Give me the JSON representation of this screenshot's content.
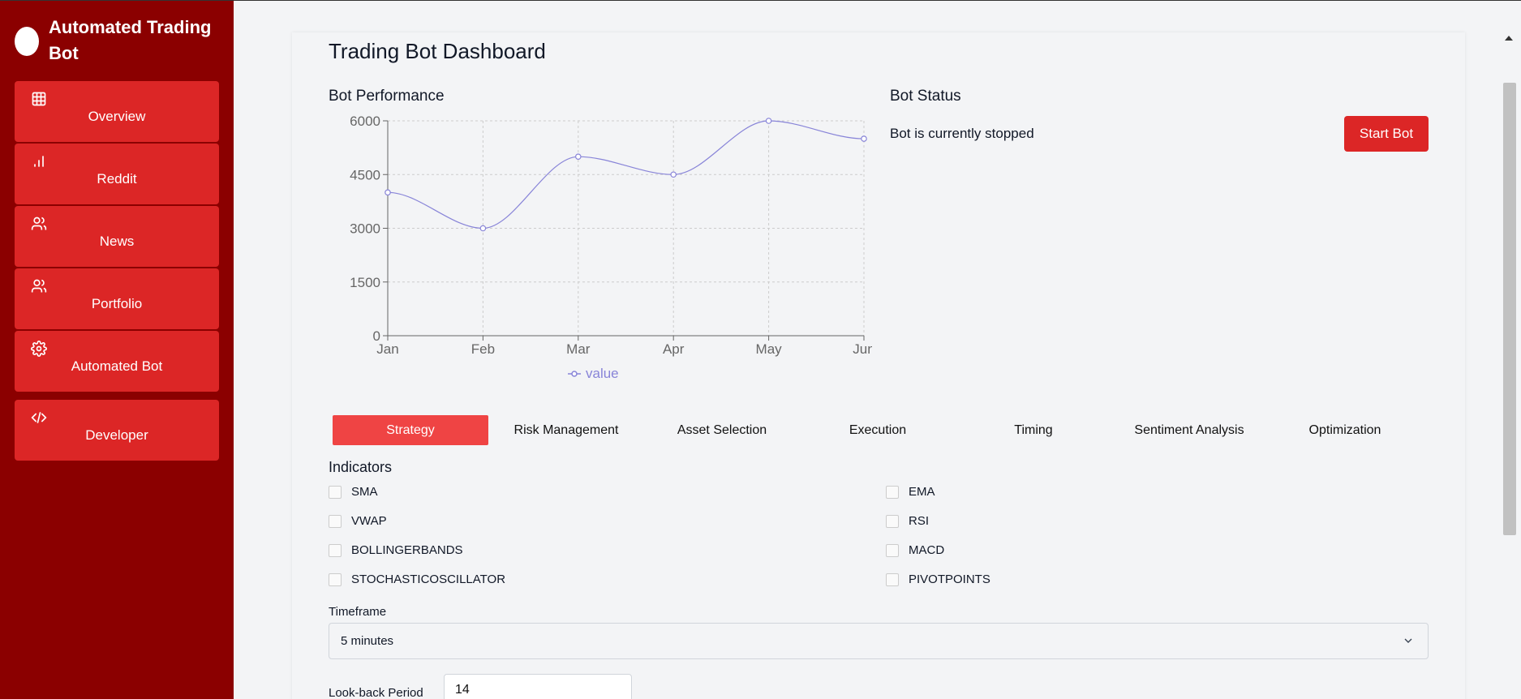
{
  "app": {
    "title": "Automated Trading Bot"
  },
  "sidebar": {
    "items": [
      {
        "label": "Overview",
        "icon": "grid-icon"
      },
      {
        "label": "Reddit",
        "icon": "bar-chart-icon"
      },
      {
        "label": "News",
        "icon": "users-icon"
      },
      {
        "label": "Portfolio",
        "icon": "users-icon"
      },
      {
        "label": "Automated Bot",
        "icon": "gear-icon"
      },
      {
        "label": "Developer",
        "icon": "code-icon"
      }
    ]
  },
  "main": {
    "title": "Trading Bot Dashboard",
    "performance_title": "Bot Performance",
    "status_title": "Bot Status",
    "status_text": "Bot is currently stopped",
    "start_button": "Start Bot",
    "legend_label": "value"
  },
  "chart_data": {
    "type": "line",
    "categories": [
      "Jan",
      "Feb",
      "Mar",
      "Apr",
      "May",
      "Jun"
    ],
    "series": [
      {
        "name": "value",
        "values": [
          4000,
          3000,
          5000,
          4500,
          6000,
          5500
        ]
      }
    ],
    "yticks": [
      0,
      1500,
      3000,
      4500,
      6000
    ],
    "ylim": [
      0,
      6000
    ],
    "grid": true,
    "color": "#8884d8",
    "legend": "bottom"
  },
  "tabs": [
    {
      "label": "Strategy",
      "active": true
    },
    {
      "label": "Risk Management"
    },
    {
      "label": "Asset Selection"
    },
    {
      "label": "Execution"
    },
    {
      "label": "Timing"
    },
    {
      "label": "Sentiment Analysis"
    },
    {
      "label": "Optimization"
    }
  ],
  "indicators": {
    "title": "Indicators",
    "left": [
      "SMA",
      "VWAP",
      "BOLLINGERBANDS",
      "STOCHASTICOSCILLATOR"
    ],
    "right": [
      "EMA",
      "RSI",
      "MACD",
      "PIVOTPOINTS"
    ]
  },
  "timeframe": {
    "label": "Timeframe",
    "value": "5 minutes"
  },
  "lookback": {
    "label": "Look-back Period",
    "value": "14"
  },
  "colors": {
    "sidebar_bg": "#8b0000",
    "nav_button": "#dc2626",
    "accent": "#ef4444",
    "chart_line": "#8884d8"
  }
}
